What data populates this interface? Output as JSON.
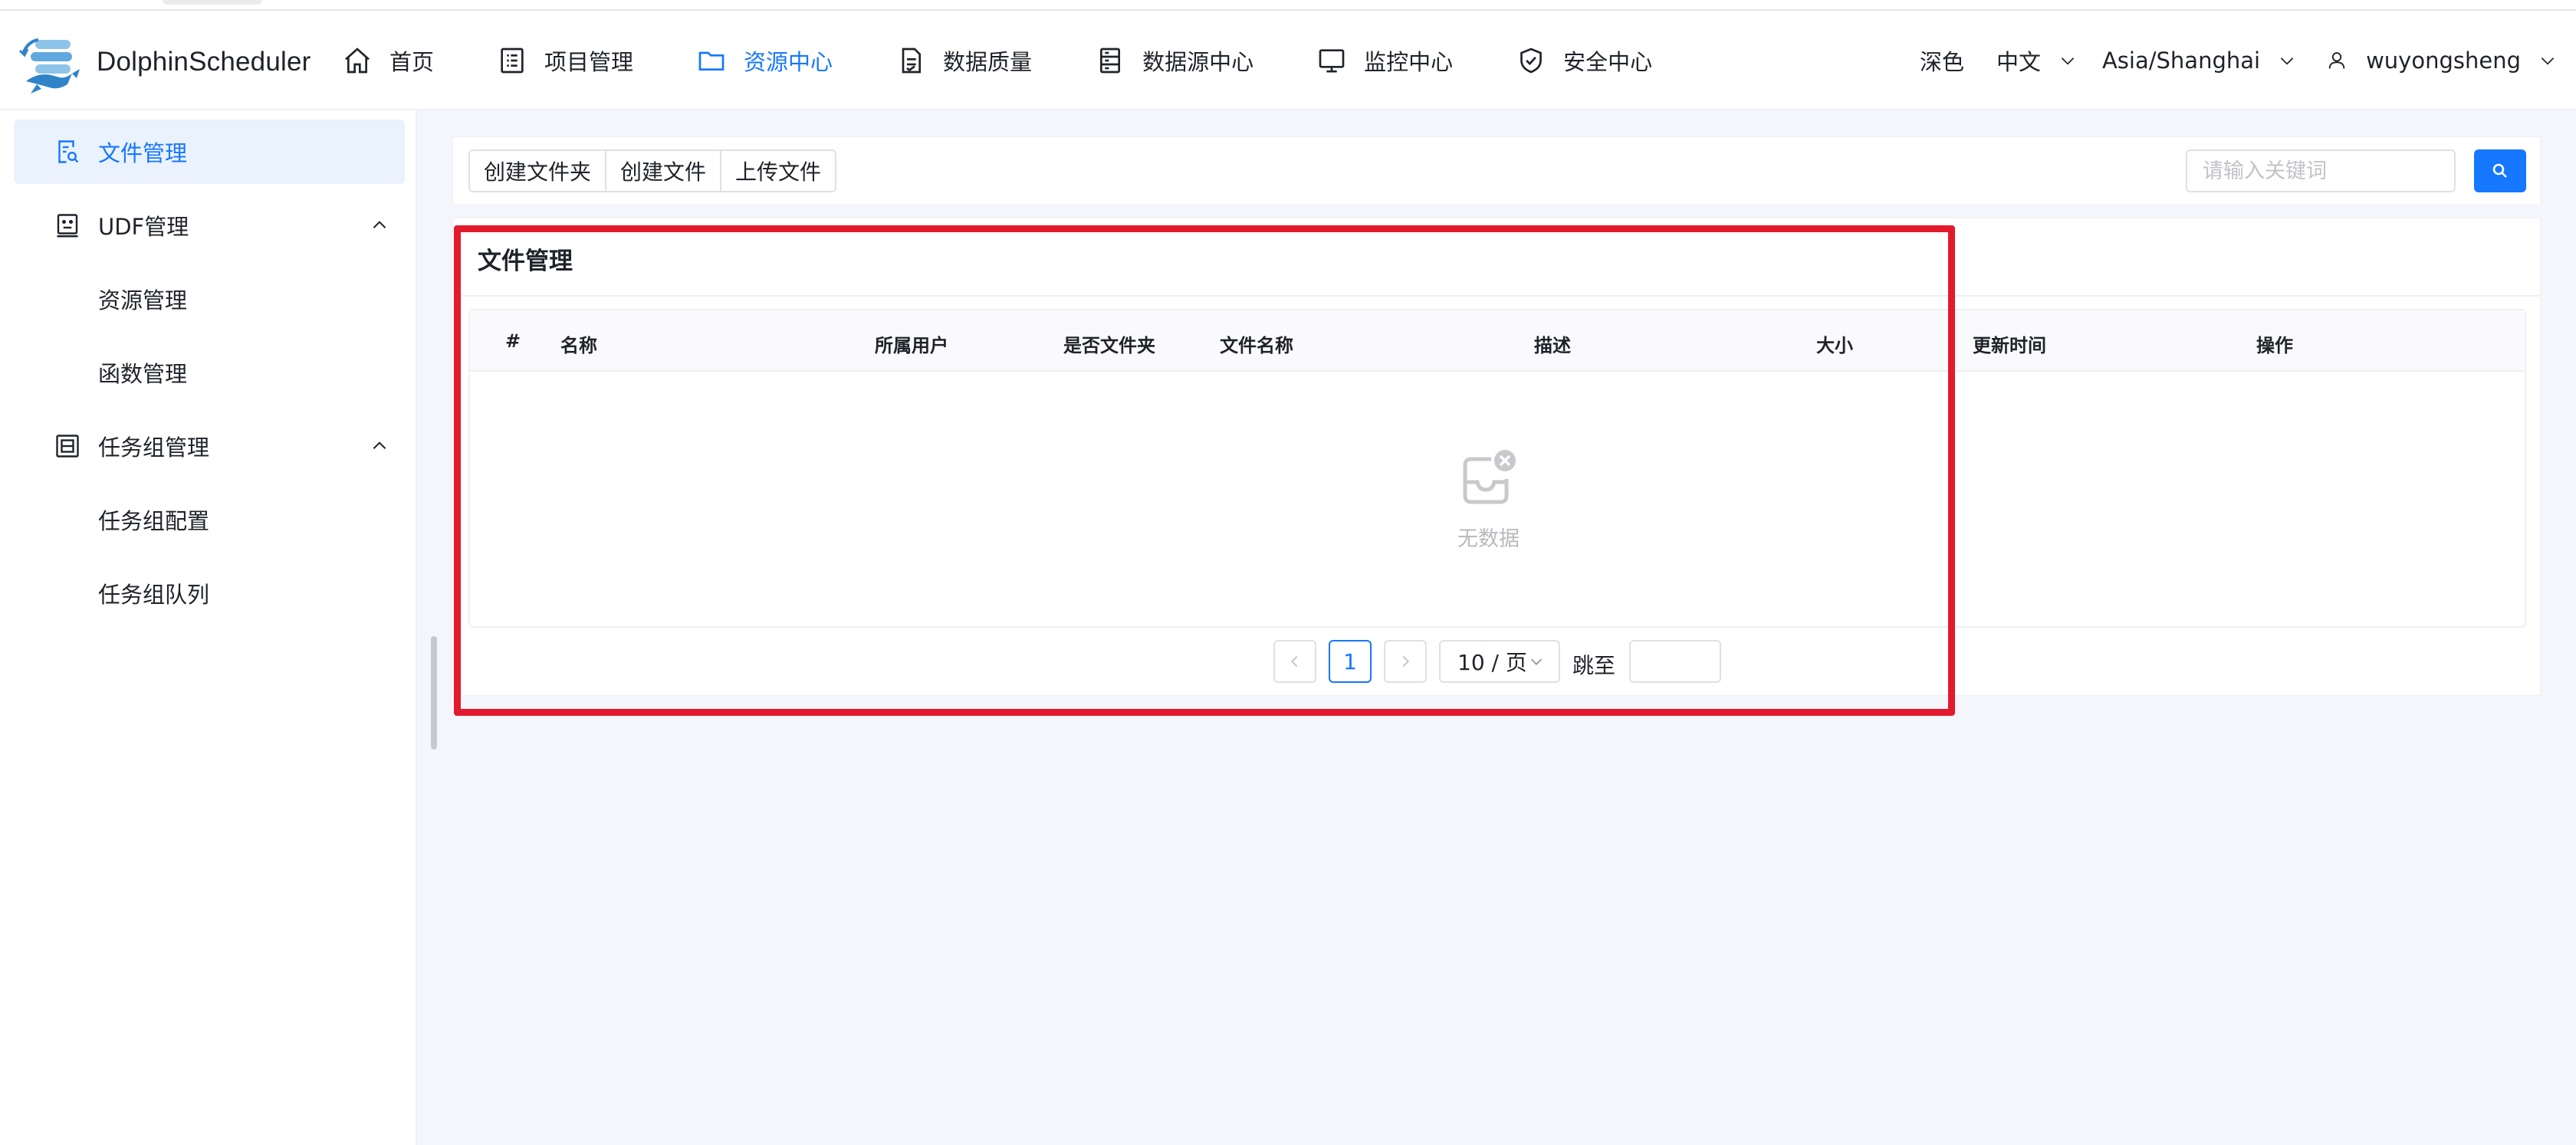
{
  "app": {
    "name": "DolphinScheduler"
  },
  "nav": {
    "items": [
      {
        "label": "首页",
        "icon": "home-icon",
        "active": false
      },
      {
        "label": "项目管理",
        "icon": "project-icon",
        "active": false
      },
      {
        "label": "资源中心",
        "icon": "folder-icon",
        "active": true
      },
      {
        "label": "数据质量",
        "icon": "data-quality-icon",
        "active": false
      },
      {
        "label": "数据源中心",
        "icon": "datasource-icon",
        "active": false
      },
      {
        "label": "监控中心",
        "icon": "monitor-icon",
        "active": false
      },
      {
        "label": "安全中心",
        "icon": "shield-icon",
        "active": false
      }
    ]
  },
  "header_right": {
    "theme": "深色",
    "language": "中文",
    "timezone": "Asia/Shanghai",
    "user": "wuyongsheng"
  },
  "sidebar": {
    "items": [
      {
        "label": "文件管理",
        "icon": "file-search-icon",
        "active": true
      },
      {
        "label": "UDF管理",
        "icon": "udf-icon",
        "expandable": true
      },
      {
        "label": "资源管理",
        "sub": true
      },
      {
        "label": "函数管理",
        "sub": true
      },
      {
        "label": "任务组管理",
        "icon": "task-group-icon",
        "expandable": true
      },
      {
        "label": "任务组配置",
        "sub": true
      },
      {
        "label": "任务组队列",
        "sub": true
      }
    ]
  },
  "toolbar": {
    "create_folder": "创建文件夹",
    "create_file": "创建文件",
    "upload_file": "上传文件",
    "search_placeholder": "请输入关键词"
  },
  "card": {
    "title": "文件管理"
  },
  "table": {
    "columns": [
      "#",
      "名称",
      "所属用户",
      "是否文件夹",
      "文件名称",
      "描述",
      "大小",
      "更新时间",
      "操作"
    ],
    "rows": [],
    "empty_text": "无数据"
  },
  "pagination": {
    "current_page": "1",
    "page_size": "10 / 页",
    "jump_label": "跳至"
  },
  "colors": {
    "primary": "#1677ff",
    "highlight": "#e21a2d"
  }
}
